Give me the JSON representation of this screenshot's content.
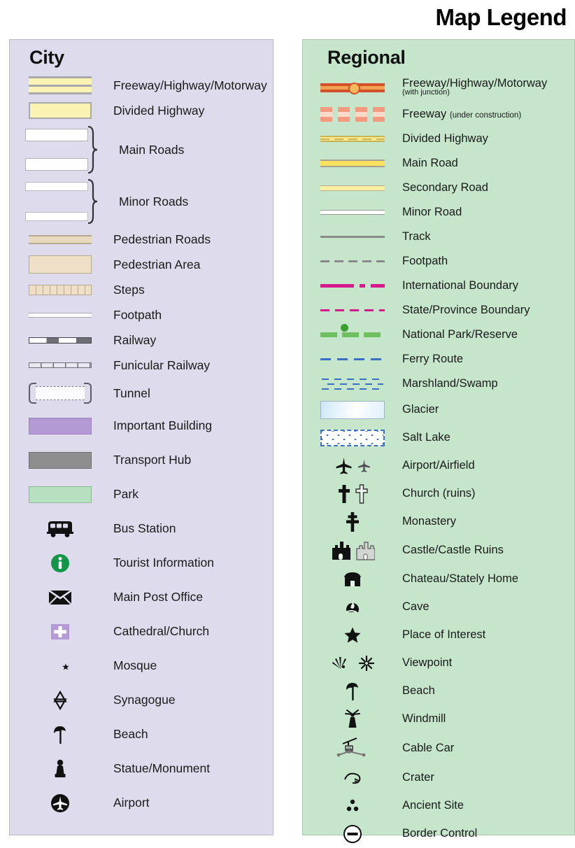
{
  "title": "Map Legend",
  "panels": {
    "city": {
      "title": "City",
      "items": [
        {
          "label": "Freeway/Highway/Motorway",
          "symbol": "freeway-dual-carriageway-swatch"
        },
        {
          "label": "Divided Highway",
          "symbol": "divided-highway-swatch"
        },
        {
          "label": "Main Roads",
          "symbol": "main-roads-bracket-swatch"
        },
        {
          "label": "Minor Roads",
          "symbol": "minor-roads-bracket-swatch"
        },
        {
          "label": "Pedestrian Roads",
          "symbol": "pedestrian-road-swatch"
        },
        {
          "label": "Pedestrian Area",
          "symbol": "pedestrian-area-swatch"
        },
        {
          "label": "Steps",
          "symbol": "steps-swatch"
        },
        {
          "label": "Footpath",
          "symbol": "footpath-line-swatch"
        },
        {
          "label": "Railway",
          "symbol": "railway-line-swatch"
        },
        {
          "label": "Funicular Railway",
          "symbol": "funicular-railway-line-swatch"
        },
        {
          "label": "Tunnel",
          "symbol": "tunnel-swatch"
        },
        {
          "label": "Important Building",
          "symbol": "important-building-swatch"
        },
        {
          "label": "Transport Hub",
          "symbol": "transport-hub-swatch"
        },
        {
          "label": "Park",
          "symbol": "park-swatch"
        },
        {
          "label": "Bus Station",
          "symbol": "bus-icon"
        },
        {
          "label": "Tourist Information",
          "symbol": "information-icon"
        },
        {
          "label": "Main Post Office",
          "symbol": "envelope-icon"
        },
        {
          "label": "Cathedral/Church",
          "symbol": "cross-on-square-icon"
        },
        {
          "label": "Mosque",
          "symbol": "crescent-star-icon"
        },
        {
          "label": "Synagogue",
          "symbol": "star-of-david-icon"
        },
        {
          "label": "Beach",
          "symbol": "parasol-icon"
        },
        {
          "label": "Statue/Monument",
          "symbol": "statue-icon"
        },
        {
          "label": "Airport",
          "symbol": "airplane-circle-icon"
        }
      ]
    },
    "regional": {
      "title": "Regional",
      "items": [
        {
          "label": "Freeway/Highway/Motorway",
          "sublabel": "(with junction)",
          "sublabel_style": "block",
          "symbol": "freeway-with-junction-swatch"
        },
        {
          "label": "Freeway",
          "sublabel": "(under construction)",
          "sublabel_style": "inline",
          "symbol": "freeway-under-construction-swatch"
        },
        {
          "label": "Divided Highway",
          "symbol": "divided-highway-line-swatch"
        },
        {
          "label": "Main Road",
          "symbol": "main-road-line-swatch"
        },
        {
          "label": "Secondary Road",
          "symbol": "secondary-road-line-swatch"
        },
        {
          "label": "Minor Road",
          "symbol": "minor-road-line-swatch"
        },
        {
          "label": "Track",
          "symbol": "track-line-swatch"
        },
        {
          "label": "Footpath",
          "symbol": "footpath-dashed-swatch"
        },
        {
          "label": "International Boundary",
          "symbol": "international-boundary-swatch"
        },
        {
          "label": "State/Province Boundary",
          "symbol": "state-boundary-swatch"
        },
        {
          "label": "National Park/Reserve",
          "symbol": "national-park-swatch"
        },
        {
          "label": "Ferry Route",
          "symbol": "ferry-route-swatch"
        },
        {
          "label": "Marshland/Swamp",
          "symbol": "marshland-swatch"
        },
        {
          "label": "Glacier",
          "symbol": "glacier-swatch"
        },
        {
          "label": "Salt Lake",
          "symbol": "salt-lake-swatch"
        },
        {
          "label": "Airport/Airfield",
          "symbol": "airplane-pair-icon"
        },
        {
          "label": "Church (ruins)",
          "symbol": "cross-pair-icon"
        },
        {
          "label": "Monastery",
          "symbol": "patriarchal-cross-icon"
        },
        {
          "label": "Castle/Castle Ruins",
          "symbol": "castle-pair-icon"
        },
        {
          "label": "Chateau/Stately Home",
          "symbol": "chateau-icon"
        },
        {
          "label": "Cave",
          "symbol": "cave-icon"
        },
        {
          "label": "Place of Interest",
          "symbol": "star-icon"
        },
        {
          "label": "Viewpoint",
          "symbol": "viewpoint-pair-icon"
        },
        {
          "label": "Beach",
          "symbol": "parasol-icon"
        },
        {
          "label": "Windmill",
          "symbol": "windmill-icon"
        },
        {
          "label": "Cable Car",
          "symbol": "cable-car-icon"
        },
        {
          "label": "Crater",
          "symbol": "crater-icon"
        },
        {
          "label": "Ancient Site",
          "symbol": "ancient-site-icon"
        },
        {
          "label": "Border Control",
          "symbol": "border-control-icon"
        }
      ]
    }
  },
  "colors": {
    "city_panel_bg": "#dedcec",
    "regional_panel_bg": "#c5e6cb",
    "highway_yellow": "#faf3b4",
    "main_road_yellow": "#fbe15e",
    "freeway_orange": "#f0a24e",
    "freeway_border_red": "#d4502c",
    "boundary_magenta": "#d6198c",
    "national_park_green": "#6fbf5e",
    "ferry_blue": "#3a6fc4",
    "important_building_purple": "#b49ad4",
    "transport_hub_gray": "#8e8e8e",
    "park_green": "#b6e0bf",
    "pedestrian_tan": "#eedfc6",
    "tourist_info_green": "#13964a"
  }
}
